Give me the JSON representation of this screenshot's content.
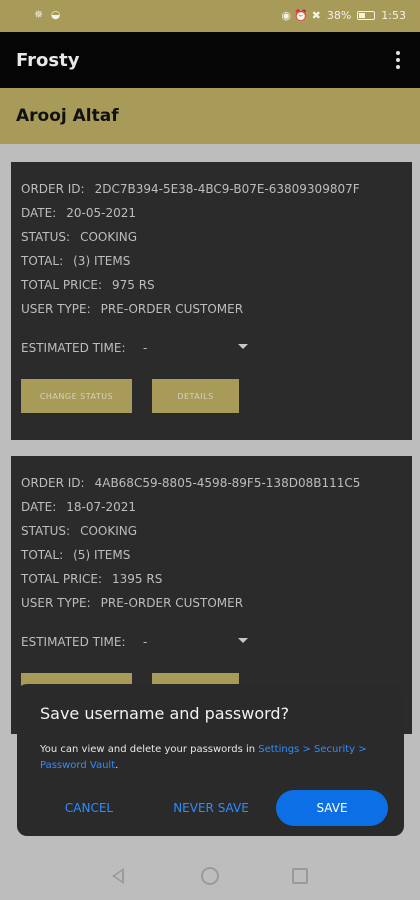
{
  "status_bar": {
    "left_icons": "✵ ◒",
    "right_icons": "◉ ⏰ ✖",
    "battery": "38%",
    "time": "1:53"
  },
  "app_bar": {
    "title": "Frosty",
    "menu_icon": "more-vert-icon"
  },
  "user": {
    "name": "Arooj Altaf"
  },
  "orders": [
    {
      "order_id_label": "ORDER ID:",
      "order_id": "2DC7B394-5E38-4BC9-B07E-63809309807F",
      "date_label": "DATE:",
      "date": "20-05-2021",
      "status_label": "STATUS:",
      "status": "COOKING",
      "total_label": "TOTAL:",
      "total": "(3) ITEMS",
      "price_label": "TOTAL PRICE:",
      "price": "975 RS",
      "user_type_label": "USER TYPE:",
      "user_type": "PRE-ORDER CUSTOMER",
      "est_label": "ESTIMATED TIME:",
      "est_value": "-",
      "change_status": "CHANGE STATUS",
      "details": "DETAILS"
    },
    {
      "order_id_label": "ORDER ID:",
      "order_id": "4AB68C59-8805-4598-89F5-138D08B111C5",
      "date_label": "DATE:",
      "date": "18-07-2021",
      "status_label": "STATUS:",
      "status": "COOKING",
      "total_label": "TOTAL:",
      "total": "(5) ITEMS",
      "price_label": "TOTAL PRICE:",
      "price": "1395 RS",
      "user_type_label": "USER TYPE:",
      "user_type": "PRE-ORDER CUSTOMER",
      "est_label": "ESTIMATED TIME:",
      "est_value": "-"
    }
  ],
  "dialog": {
    "title": "Save username and password?",
    "message_prefix": "You can view and delete your passwords in ",
    "message_link": "Settings > Security > Password Vault",
    "message_suffix": ".",
    "cancel": "CANCEL",
    "never_save": "NEVER SAVE",
    "save": "SAVE",
    "accent": "#0c6fe5"
  },
  "colors": {
    "gold": "#a89a58",
    "card": "#2b2b2b",
    "app_bar": "#050505"
  }
}
